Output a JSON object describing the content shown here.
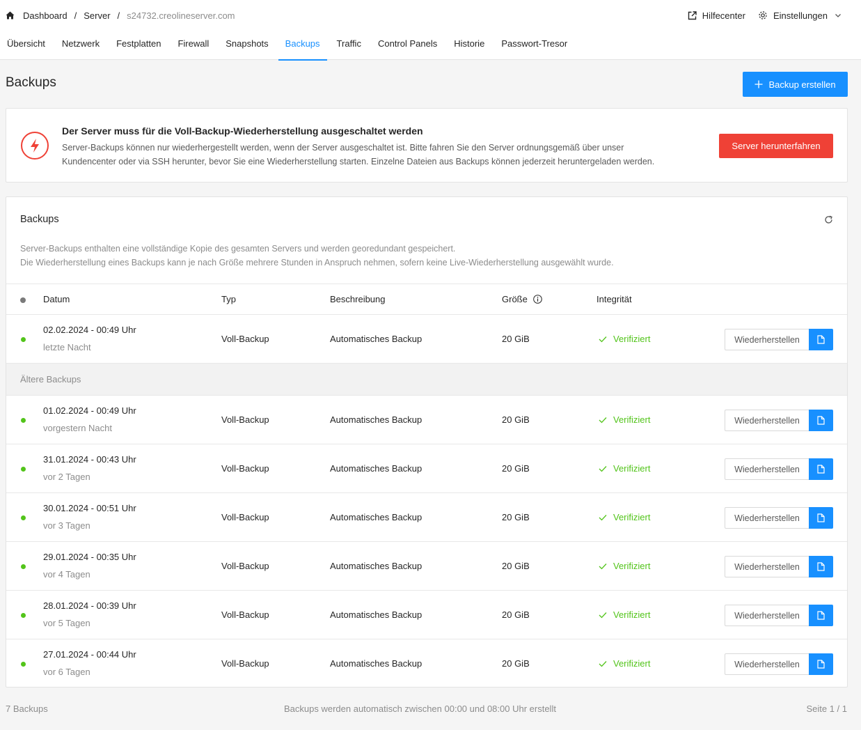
{
  "breadcrumb": {
    "home_icon": "home-icon",
    "items": [
      "Dashboard",
      "Server",
      "s24732.creolineserver.com"
    ],
    "separator": "/"
  },
  "top_links": {
    "help_label": "Hilfecenter",
    "help_icon": "external-link-icon",
    "settings_label": "Einstellungen",
    "settings_icon": "gear-icon"
  },
  "tabs": [
    {
      "label": "Übersicht"
    },
    {
      "label": "Netzwerk"
    },
    {
      "label": "Festplatten"
    },
    {
      "label": "Firewall"
    },
    {
      "label": "Snapshots"
    },
    {
      "label": "Backups",
      "active": true
    },
    {
      "label": "Traffic"
    },
    {
      "label": "Control Panels"
    },
    {
      "label": "Historie"
    },
    {
      "label": "Passwort-Tresor"
    }
  ],
  "page": {
    "title": "Backups",
    "create_button": "Backup erstellen"
  },
  "alert": {
    "title": "Der Server muss für die Voll-Backup-Wiederherstellung ausgeschaltet werden",
    "text_line1": "Server-Backups können nur wiederhergestellt werden, wenn der Server ausgeschaltet ist. Bitte fahren Sie den Server ordnungsgemäß über unser",
    "text_line2": "Kundencenter oder via SSH herunter, bevor Sie eine Wiederherstellung starten. Einzelne Dateien aus Backups können jederzeit heruntergeladen werden.",
    "button": "Server herunterfahren",
    "icon": "lightning-icon"
  },
  "card": {
    "title": "Backups",
    "desc_line1": "Server-Backups enthalten eine vollständige Kopie des gesamten Servers und werden georedundant gespeichert.",
    "desc_line2": "Die Wiederherstellung eines Backups kann je nach Größe mehrere Stunden in Anspruch nehmen, sofern keine Live-Wiederherstellung ausgewählt wurde."
  },
  "table": {
    "headers": {
      "date": "Datum",
      "type": "Typ",
      "description": "Beschreibung",
      "size": "Größe",
      "integrity": "Integrität"
    },
    "older_section": "Ältere Backups",
    "restore_label": "Wiederherstellen",
    "rows": [
      {
        "date": "02.02.2024 - 00:49 Uhr",
        "relative": "letzte Nacht",
        "type": "Voll-Backup",
        "description": "Automatisches Backup",
        "size": "20 GiB",
        "integrity": "Verifiziert"
      },
      {
        "date": "01.02.2024 - 00:49 Uhr",
        "relative": "vorgestern Nacht",
        "type": "Voll-Backup",
        "description": "Automatisches Backup",
        "size": "20 GiB",
        "integrity": "Verifiziert"
      },
      {
        "date": "31.01.2024 - 00:43 Uhr",
        "relative": "vor 2 Tagen",
        "type": "Voll-Backup",
        "description": "Automatisches Backup",
        "size": "20 GiB",
        "integrity": "Verifiziert"
      },
      {
        "date": "30.01.2024 - 00:51 Uhr",
        "relative": "vor 3 Tagen",
        "type": "Voll-Backup",
        "description": "Automatisches Backup",
        "size": "20 GiB",
        "integrity": "Verifiziert"
      },
      {
        "date": "29.01.2024 - 00:35 Uhr",
        "relative": "vor 4 Tagen",
        "type": "Voll-Backup",
        "description": "Automatisches Backup",
        "size": "20 GiB",
        "integrity": "Verifiziert"
      },
      {
        "date": "28.01.2024 - 00:39 Uhr",
        "relative": "vor 5 Tagen",
        "type": "Voll-Backup",
        "description": "Automatisches Backup",
        "size": "20 GiB",
        "integrity": "Verifiziert"
      },
      {
        "date": "27.01.2024 - 00:44 Uhr",
        "relative": "vor 6 Tagen",
        "type": "Voll-Backup",
        "description": "Automatisches Backup",
        "size": "20 GiB",
        "integrity": "Verifiziert"
      }
    ]
  },
  "footer": {
    "count": "7 Backups",
    "note": "Backups werden automatisch zwischen 00:00 und 08:00 Uhr erstellt",
    "pagination": "Seite 1 / 1"
  },
  "colors": {
    "primary": "#1890ff",
    "danger": "#ef4136",
    "success": "#52c41a"
  }
}
